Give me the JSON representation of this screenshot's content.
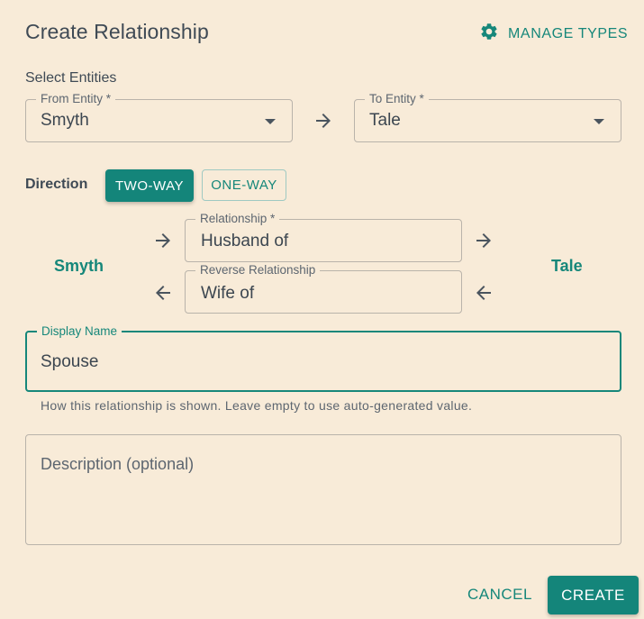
{
  "dialog": {
    "title": "Create Relationship",
    "manage_types_label": "MANAGE TYPES",
    "select_entities_label": "Select Entities"
  },
  "from_entity": {
    "label": "From Entity *",
    "value": "Smyth"
  },
  "to_entity": {
    "label": "To Entity *",
    "value": "Tale"
  },
  "direction": {
    "label": "Direction",
    "options": [
      "TWO-WAY",
      "ONE-WAY"
    ],
    "selected": "TWO-WAY"
  },
  "preview": {
    "from_name": "Smyth",
    "to_name": "Tale",
    "relationship": {
      "label": "Relationship *",
      "value": "Husband of"
    },
    "reverse_relationship": {
      "label": "Reverse Relationship",
      "value": "Wife of"
    }
  },
  "display_name": {
    "label": "Display Name",
    "value": "Spouse",
    "helper": "How this relationship is shown. Leave empty to use auto-generated value."
  },
  "description": {
    "placeholder": "Description (optional)",
    "value": ""
  },
  "actions": {
    "cancel_label": "CANCEL",
    "create_label": "CREATE"
  },
  "colors": {
    "accent": "#14857a",
    "background": "#f8ebd8",
    "border": "#b9b3aa"
  },
  "icons": {
    "manage": "gear-icon",
    "forward": "arrow-right-icon",
    "back": "arrow-left-icon",
    "dropdown": "caret-down-icon"
  }
}
